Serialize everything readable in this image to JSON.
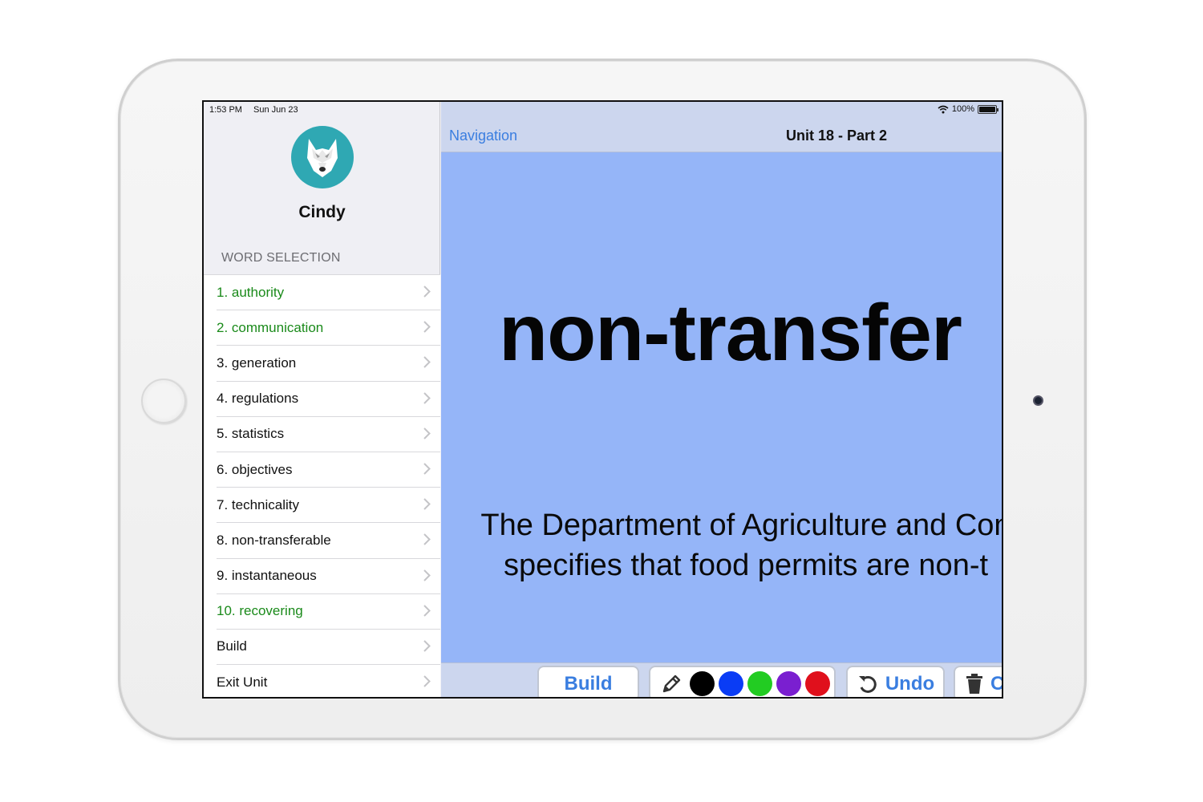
{
  "status_bar": {
    "time": "1:53 PM",
    "date": "Sun Jun 23",
    "battery": "100%"
  },
  "profile": {
    "name": "Cindy"
  },
  "sidebar": {
    "section_header": "WORD SELECTION",
    "items": [
      {
        "label": "1. authority",
        "completed": true
      },
      {
        "label": "2. communication",
        "completed": true
      },
      {
        "label": "3. generation",
        "completed": false
      },
      {
        "label": "4. regulations",
        "completed": false
      },
      {
        "label": "5. statistics",
        "completed": false
      },
      {
        "label": "6. objectives",
        "completed": false
      },
      {
        "label": "7. technicality",
        "completed": false
      },
      {
        "label": "8. non-transferable",
        "completed": false
      },
      {
        "label": "9. instantaneous",
        "completed": false
      },
      {
        "label": "10. recovering",
        "completed": true
      },
      {
        "label": "Build",
        "completed": false
      },
      {
        "label": "Exit Unit",
        "completed": false
      }
    ]
  },
  "nav": {
    "back_label": "Navigation",
    "title": "Unit 18 - Part 2"
  },
  "content": {
    "word": "non-transfer",
    "sentence_line1": "The Department of Agriculture and Con",
    "sentence_line2": "specifies that food permits are non-t"
  },
  "toolbar": {
    "build_label": "Build",
    "undo_label": "Undo",
    "trash_label": "C",
    "colors": [
      "#000000",
      "#0a3cf5",
      "#22cc22",
      "#7a1fd0",
      "#e0101c"
    ]
  },
  "theme": {
    "content_bg": "#95b5f8",
    "accent": "#3a7ee0",
    "completed": "#1a8a1a"
  }
}
